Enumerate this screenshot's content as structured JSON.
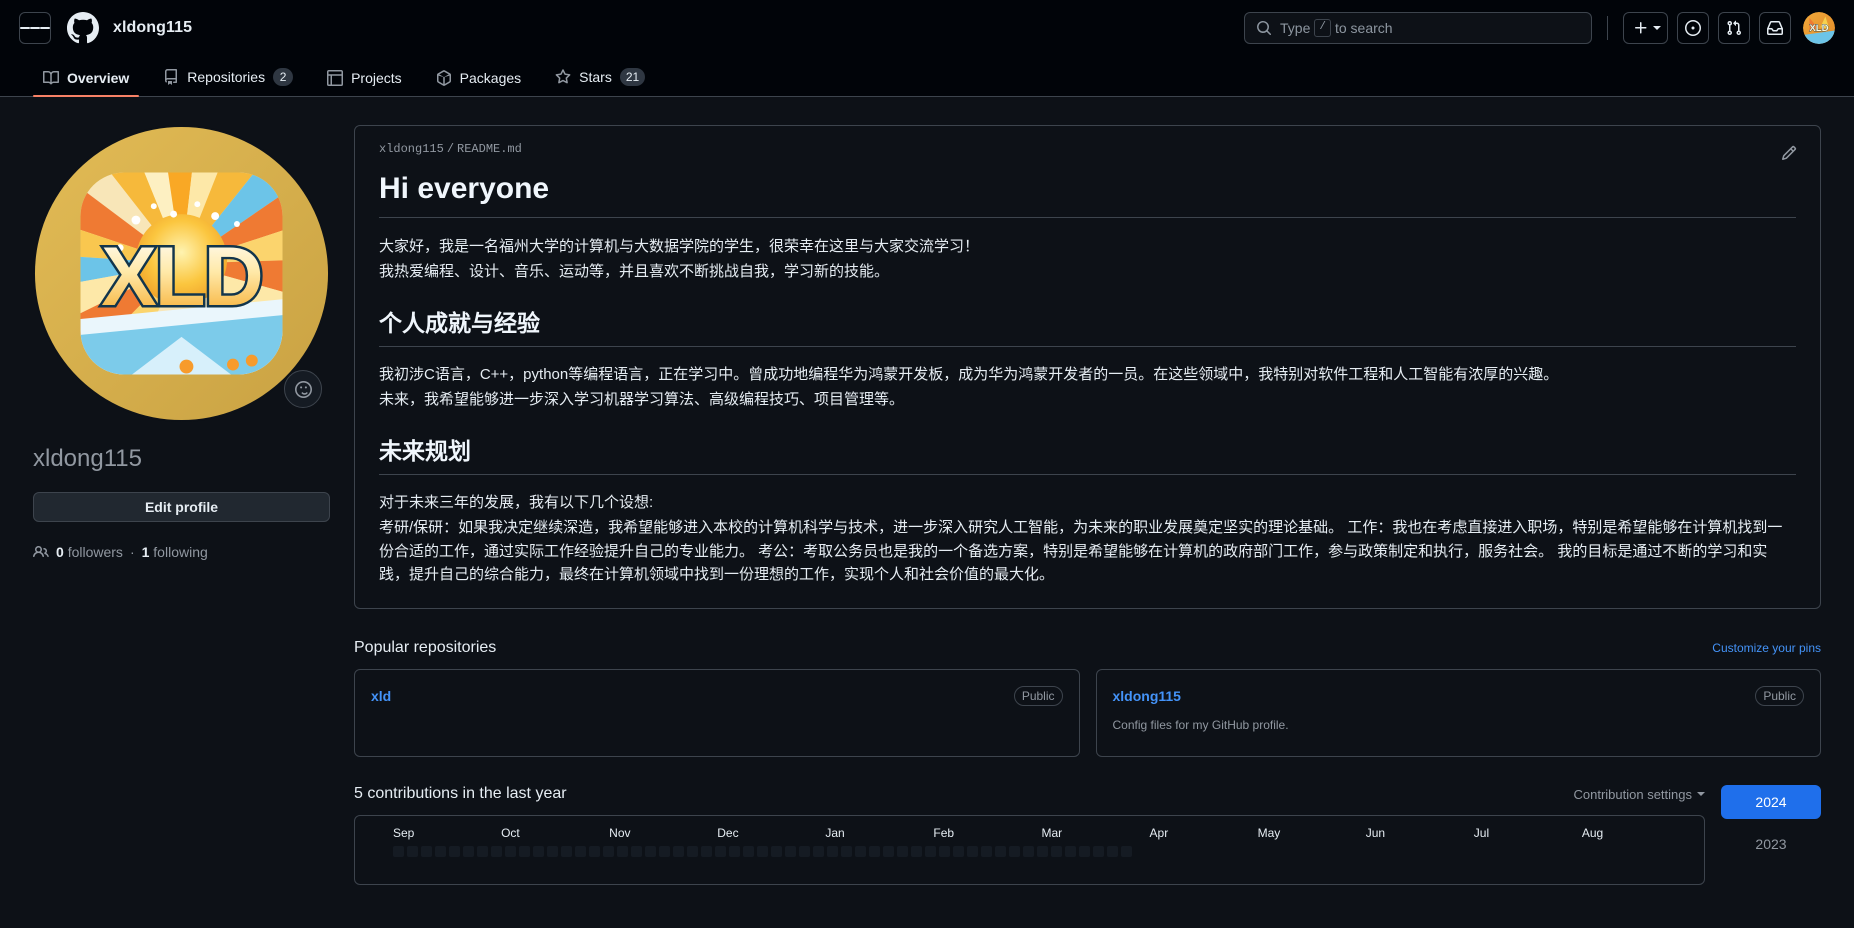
{
  "header": {
    "menu_icon": "hamburger-icon",
    "logo_icon": "github-logo-icon",
    "owner": "xldong115",
    "search": {
      "placeholder_before": "Type",
      "slash_key": "/",
      "placeholder_after": "to search"
    },
    "create_icon": "plus-icon",
    "issues_icon": "issue-opened-icon",
    "pulls_icon": "git-pull-request-icon",
    "inbox_icon": "inbox-icon",
    "avatar_icon": "user-avatar"
  },
  "nav": {
    "tabs": [
      {
        "label": "Overview",
        "icon": "book-icon",
        "count": null,
        "active": true
      },
      {
        "label": "Repositories",
        "icon": "repo-icon",
        "count": "2",
        "active": false
      },
      {
        "label": "Projects",
        "icon": "table-icon",
        "count": null,
        "active": false
      },
      {
        "label": "Packages",
        "icon": "package-icon",
        "count": null,
        "active": false
      },
      {
        "label": "Stars",
        "icon": "star-icon",
        "count": "21",
        "active": false
      }
    ],
    "active_underline_color": "#f78166"
  },
  "profile": {
    "avatar_alt": "XLD sunburst logo avatar",
    "status_icon": "smiley-icon",
    "username": "xldong115",
    "edit_profile_label": "Edit profile",
    "followers_icon": "people-icon",
    "followers_count": "0",
    "followers_label": "followers",
    "separator": "·",
    "following_count": "1",
    "following_label": "following"
  },
  "readme": {
    "owner": "xldong115",
    "path_sep": "/",
    "filename": "README.md",
    "edit_icon": "pencil-icon",
    "h1": "Hi everyone",
    "intro_line1": "大家好，我是一名福州大学的计算机与大数据学院的学生，很荣幸在这里与大家交流学习！",
    "intro_line2": "我热爱编程、设计、音乐、运动等，并且喜欢不断挑战自我，学习新的技能。",
    "h2_achievements": "个人成就与经验",
    "ach_line1": "我初涉C语言，C++，python等编程语言，正在学习中。曾成功地编程华为鸿蒙开发板，成为华为鸿蒙开发者的一员。在这些领域中，我特别对软件工程和人工智能有浓厚的兴趣。",
    "ach_line2": "未来，我希望能够进一步深入学习机器学习算法、高级编程技巧、项目管理等。",
    "h2_future": "未来规划",
    "fut_line1": "对于未来三年的发展，我有以下几个设想:",
    "fut_line2": "考研/保研：如果我决定继续深造，我希望能够进入本校的计算机科学与技术，进一步深入研究人工智能，为未来的职业发展奠定坚实的理论基础。 工作：我也在考虑直接进入职场，特别是希望能够在计算机找到一份合适的工作，通过实际工作经验提升自己的专业能力。 考公：考取公务员也是我的一个备选方案，特别是希望能够在计算机的政府部门工作，参与政策制定和执行，服务社会。 我的目标是通过不断的学习和实践，提升自己的综合能力，最终在计算机领域中找到一份理想的工作，实现个人和社会价值的最大化。"
  },
  "popular_repos": {
    "title": "Popular repositories",
    "customize_link": "Customize your pins",
    "items": [
      {
        "name": "xld",
        "visibility": "Public",
        "description": ""
      },
      {
        "name": "xldong115",
        "visibility": "Public",
        "description": "Config files for my GitHub profile."
      }
    ]
  },
  "contributions": {
    "title": "5 contributions in the last year",
    "settings_label": "Contribution settings",
    "settings_icon": "chevron-down-icon",
    "months": [
      "Sep",
      "Oct",
      "Nov",
      "Dec",
      "Jan",
      "Feb",
      "Mar",
      "Apr",
      "May",
      "Jun",
      "Jul",
      "Aug"
    ],
    "years": [
      {
        "label": "2024",
        "selected": true
      },
      {
        "label": "2023",
        "selected": false
      }
    ],
    "selected_year_color": "#1f6feb"
  }
}
